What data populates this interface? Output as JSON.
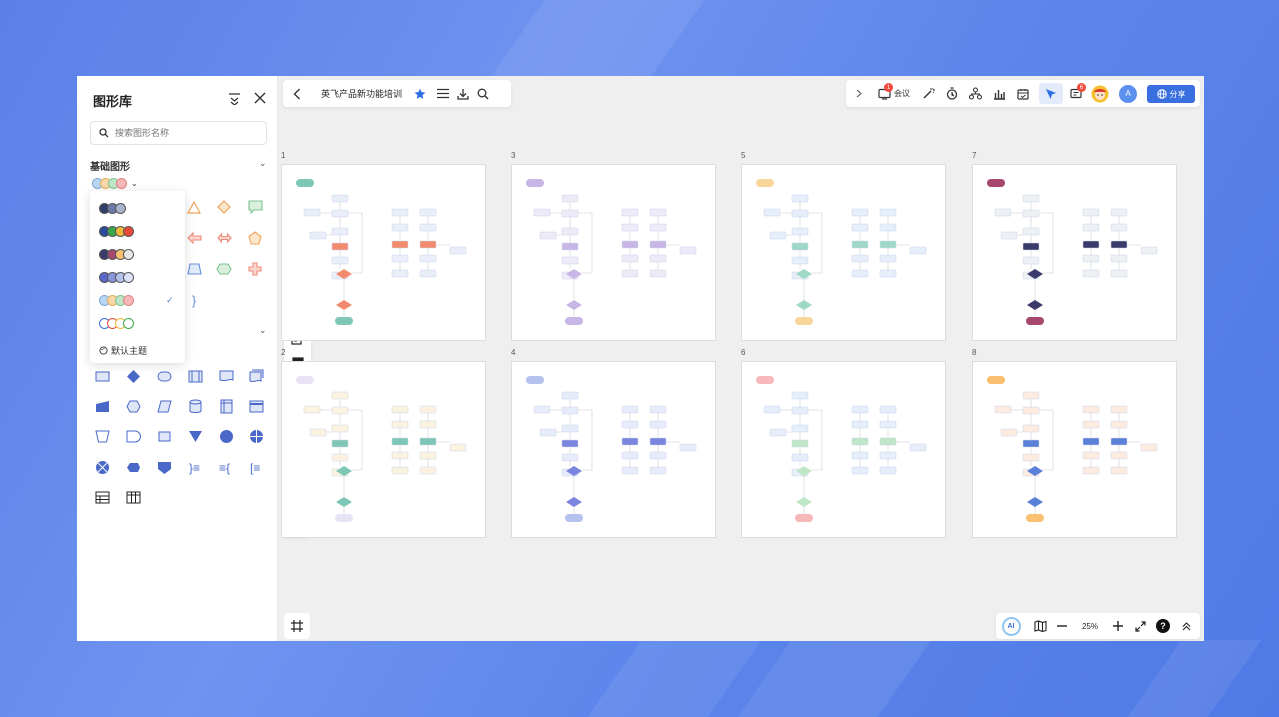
{
  "library": {
    "title": "图形库",
    "search_placeholder": "搜索图形名称",
    "basic_section": "基础图形",
    "default_theme": "默认主题"
  },
  "document": {
    "title": "英飞产品新功能培训"
  },
  "toolbar": {
    "meeting_label": "会议",
    "meeting_badge": "1",
    "comments_badge": "6",
    "avatar_letter": "A",
    "share_label": "分享"
  },
  "zoom": {
    "level": "25%",
    "ai_label": "AI"
  },
  "pages": [
    {
      "label": "1",
      "accent": "#7ec7b6",
      "main": "#f28b6e",
      "side": "#e9eef9"
    },
    {
      "label": "2",
      "accent": "#e9e3f6",
      "main": "#7ec7b6",
      "side": "#fbf3df"
    },
    {
      "label": "3",
      "accent": "#c8b6e6",
      "main": "#c8b6e6",
      "side": "#efeaf8"
    },
    {
      "label": "4",
      "accent": "#b5c2ee",
      "main": "#7b85de",
      "side": "#e7ecfb"
    },
    {
      "label": "5",
      "accent": "#f8d59a",
      "main": "#9fd8c7",
      "side": "#e6eefa"
    },
    {
      "label": "6",
      "accent": "#f6b8b8",
      "main": "#bfe6c7",
      "side": "#e6eefa"
    },
    {
      "label": "7",
      "accent": "#a6486d",
      "main": "#3b3b6b",
      "side": "#eef1f4"
    },
    {
      "label": "8",
      "accent": "#f8c070",
      "main": "#5a80d8",
      "side": "#fdebe0"
    }
  ],
  "colors": {
    "brand": "#3a6fe0",
    "badge": "#f04a3b"
  }
}
